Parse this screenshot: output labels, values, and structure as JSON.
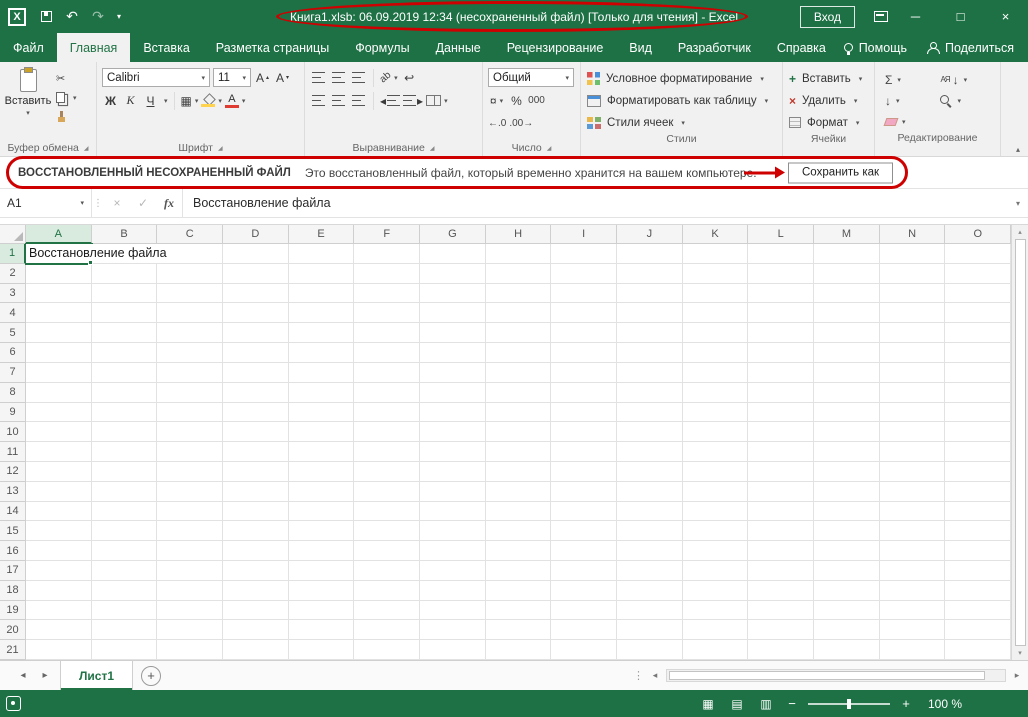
{
  "colors": {
    "excel_green": "#1e7145",
    "accent": "#217346",
    "annotation_red": "#ce0000"
  },
  "titlebar": {
    "title": "Книга1.xlsb: 06.09.2019 12:34  (несохраненный файл)  [Только для чтения]  -  Excel",
    "sign_in": "Вход"
  },
  "tabs": [
    {
      "id": "file",
      "label": "Файл",
      "active": false
    },
    {
      "id": "home",
      "label": "Главная",
      "active": true
    },
    {
      "id": "insert",
      "label": "Вставка",
      "active": false
    },
    {
      "id": "page-layout",
      "label": "Разметка страницы",
      "active": false
    },
    {
      "id": "formulas",
      "label": "Формулы",
      "active": false
    },
    {
      "id": "data",
      "label": "Данные",
      "active": false
    },
    {
      "id": "review",
      "label": "Рецензирование",
      "active": false
    },
    {
      "id": "view",
      "label": "Вид",
      "active": false
    },
    {
      "id": "developer",
      "label": "Разработчик",
      "active": false
    },
    {
      "id": "help",
      "label": "Справка",
      "active": false
    }
  ],
  "tabbar": {
    "help": "Помощь",
    "share": "Поделиться"
  },
  "ribbon": {
    "clipboard": {
      "group": "Буфер обмена",
      "paste": "Вставить"
    },
    "font": {
      "group": "Шрифт",
      "name": "Calibri",
      "size": "11",
      "bold": "Ж",
      "italic": "К",
      "underline": "Ч"
    },
    "alignment": {
      "group": "Выравнивание"
    },
    "number": {
      "group": "Число",
      "format": "Общий",
      "percent": "%",
      "thousands": "000"
    },
    "styles": {
      "group": "Стили",
      "conditional": "Условное форматирование",
      "format_as_table": "Форматировать как таблицу",
      "cell_styles": "Стили ячеек"
    },
    "cells": {
      "group": "Ячейки",
      "insert": "Вставить",
      "delete": "Удалить",
      "format": "Формат"
    },
    "editing": {
      "group": "Редактирование"
    }
  },
  "recovery": {
    "title": "ВОССТАНОВЛЕННЫЙ НЕСОХРАНЕННЫЙ ФАЙЛ",
    "message": "Это восстановленный файл, который временно хранится на вашем компьютере.",
    "save_as": "Сохранить как"
  },
  "formula_bar": {
    "name_box": "A1",
    "fx": "fx",
    "content": "Восстановление файла"
  },
  "grid": {
    "columns": [
      "A",
      "B",
      "C",
      "D",
      "E",
      "F",
      "G",
      "H",
      "I",
      "J",
      "K",
      "L",
      "M",
      "N",
      "O"
    ],
    "rows": [
      "1",
      "2",
      "3",
      "4",
      "5",
      "6",
      "7",
      "8",
      "9",
      "10",
      "11",
      "12",
      "13",
      "14",
      "15",
      "16",
      "17",
      "18",
      "19",
      "20",
      "21"
    ],
    "selected_cell": "A1",
    "cells": {
      "A1": "Восстановление файла"
    }
  },
  "sheets": [
    {
      "label": "Лист1",
      "active": true
    }
  ],
  "status": {
    "zoom": "100 %"
  },
  "icons": {
    "dropdown": "▾",
    "up_small": "▴",
    "tri_left": "◂",
    "tri_right": "▸",
    "scissors": "✂",
    "undo": "↶",
    "redo": "↷",
    "sum": "Σ",
    "arrow_down": "↓",
    "wrap_return": "↩",
    "currency": "¤",
    "check": "✓",
    "close": "×",
    "maximize": "□",
    "minimize": "─",
    "letter_a": "А",
    "sort_letters": "АЯ",
    "inc_decimal": "←.0",
    "dec_decimal": ".00→",
    "plus": "+",
    "minus": "−",
    "orientation_text": "ab",
    "grip_dots": "⋮",
    "excel_x": "X",
    "borders": "▦",
    "view_normal": "▦",
    "view_layout": "▤",
    "view_break": "▥"
  }
}
